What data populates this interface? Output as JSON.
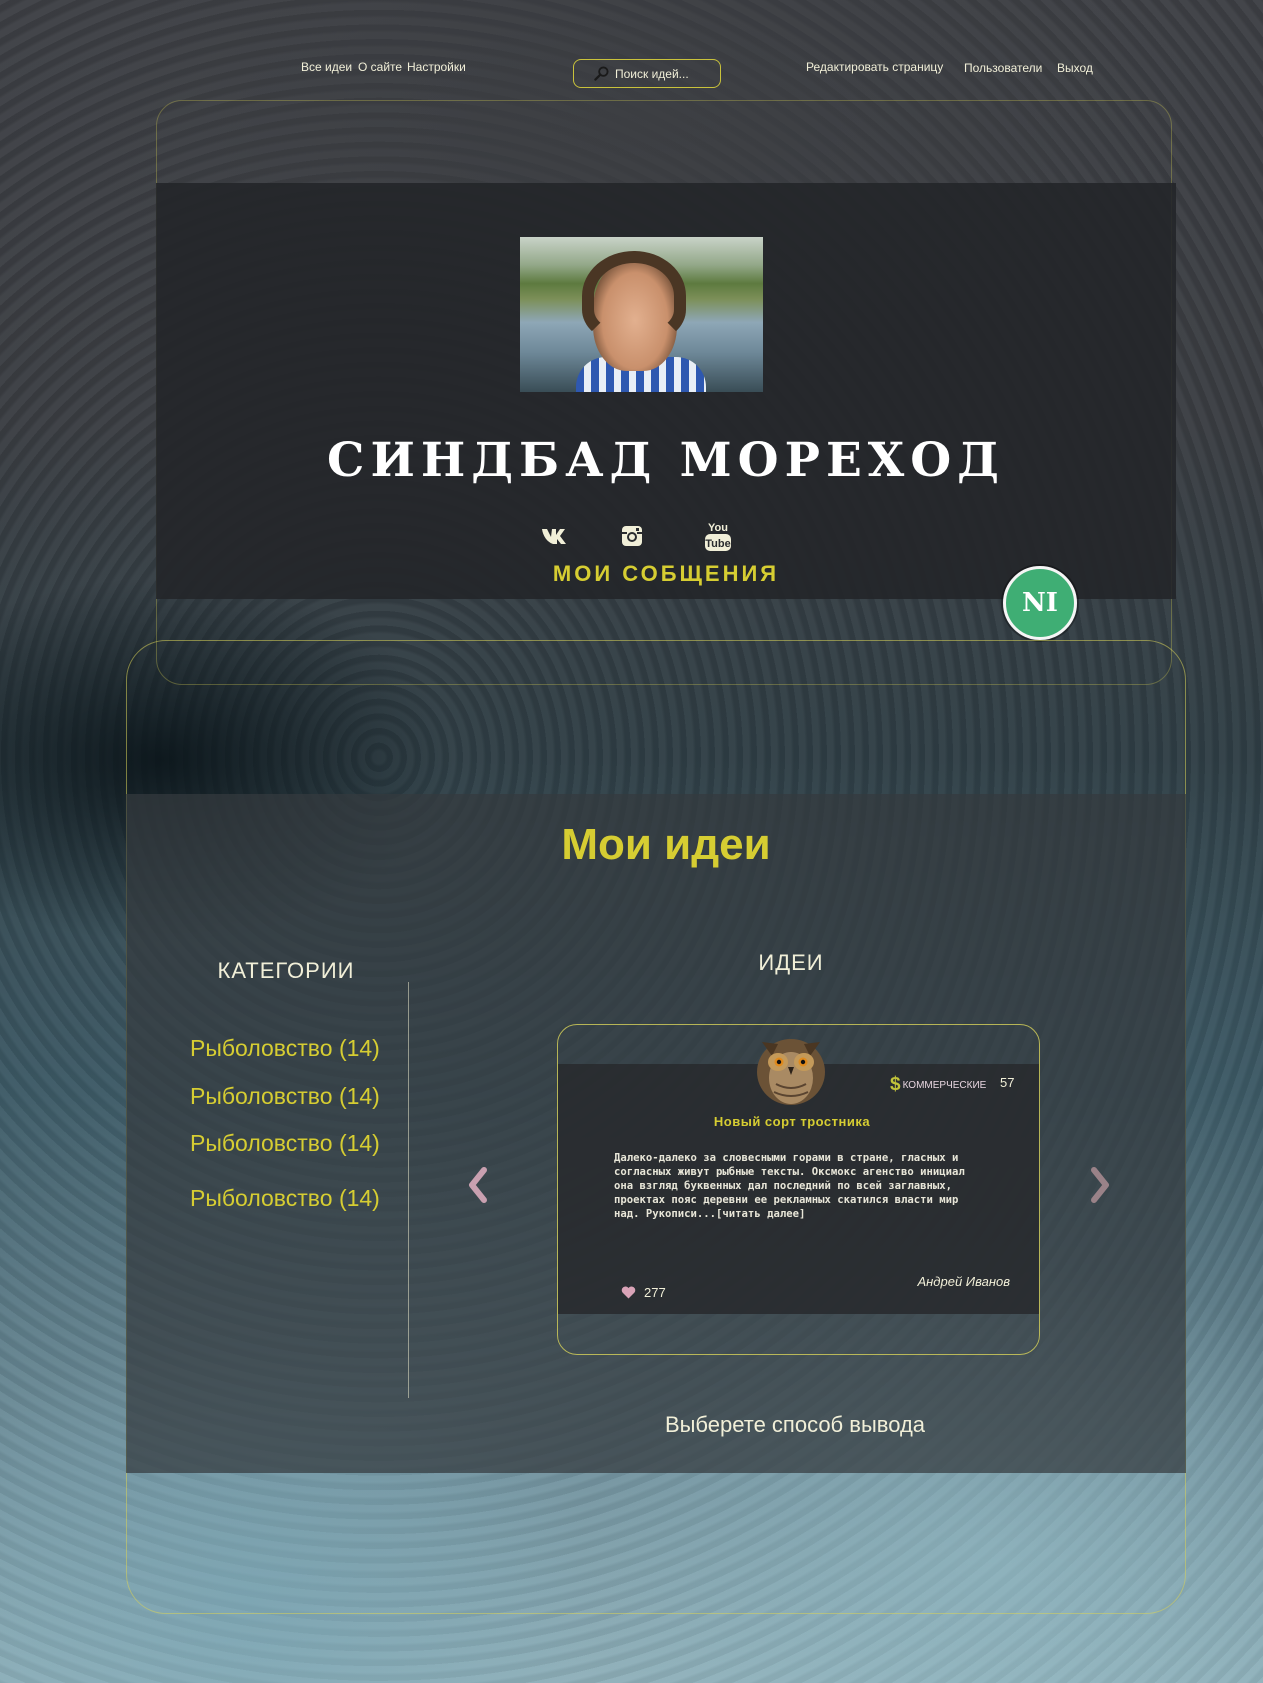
{
  "nav": {
    "all_ideas": "Все идеи",
    "about": "О сайте",
    "settings": "Настройки",
    "search_placeholder": "Поиск идей...",
    "edit_page": "Редактировать страницу",
    "users": "Пользователи",
    "logout": "Выход"
  },
  "profile": {
    "name": "СИНДБАД МОРЕХОД",
    "social": [
      "vk-icon",
      "instagram-icon",
      "youtube-icon"
    ],
    "messages_link": "МОИ СОБЩЕНИЯ",
    "badge": "NI"
  },
  "ideas_section": {
    "title": "Мои идеи",
    "categories_title": "КАТЕГОРИИ",
    "categories": [
      {
        "label": "Рыболовство (14)"
      },
      {
        "label": "Рыболовство (14)"
      },
      {
        "label": "Рыболовство (14)"
      },
      {
        "label": "Рыболовство (14)"
      }
    ],
    "ideas_title": "ИДЕИ",
    "card": {
      "type": "КОММЕРЧЕСКИЕ",
      "count": "57",
      "title": "Новый сорт тростника",
      "text": "Далеко-далеко за словесными горами в стране, гласных и согласных живут рыбные тексты. Оксмокс агенство инициал она взгляд буквенных дал последний по всей заглавных, проектах пояс деревни ее рекламных скатился власти мир над. Рукописи...[читать далее]",
      "author": "Андрей Иванов",
      "likes": "277"
    },
    "output_label": "Выберете способ вывода"
  },
  "colors": {
    "accent_yellow": "#d6cd32",
    "badge_green": "#3fae74",
    "arrow_pink": "#c9a0b0"
  }
}
